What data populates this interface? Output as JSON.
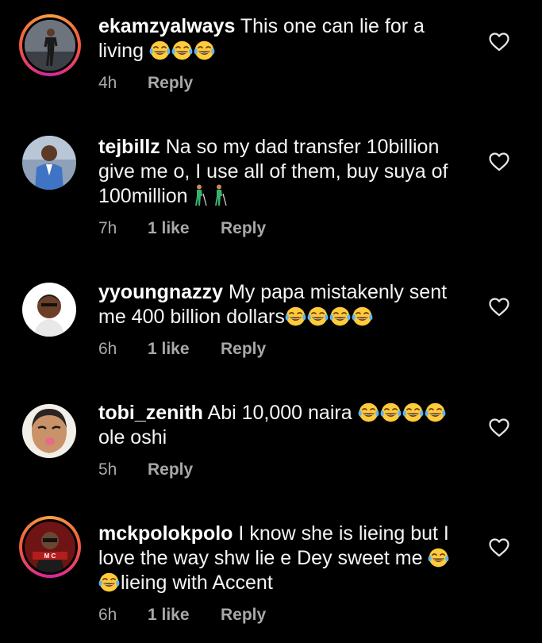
{
  "comments": [
    {
      "username": "ekamzyalways",
      "text_parts": [
        "This one can lie for a living "
      ],
      "emoji_after": 3,
      "time": "4h",
      "likes": "",
      "reply": "Reply",
      "has_story_ring": true
    },
    {
      "username": "tejbillz",
      "text_parts": [
        "Na so my dad transfer 10billion give me o, I use all of them, buy suya of 100million"
      ],
      "walk_emoji_after": 2,
      "time": "7h",
      "likes": "1 like",
      "reply": "Reply",
      "has_story_ring": false
    },
    {
      "username": "yyoungnazzy",
      "text_parts": [
        "My papa mistakenly sent me 400 billion dollars"
      ],
      "emoji_after": 4,
      "time": "6h",
      "likes": "1 like",
      "reply": "Reply",
      "has_story_ring": false
    },
    {
      "username": "tobi_zenith",
      "text_parts": [
        "Abi 10,000 naira ",
        "ole oshi"
      ],
      "emoji_middle": 4,
      "time": "5h",
      "likes": "",
      "reply": "Reply",
      "has_story_ring": false
    },
    {
      "username": "mckpolokpolo",
      "text_parts": [
        "I know she is lieing but I love the way shw lie e Dey sweet me ",
        "lieing with  Accent"
      ],
      "emoji_middle": 2,
      "time": "6h",
      "likes": "1 like",
      "reply": "Reply",
      "has_story_ring": true
    }
  ],
  "icons": {
    "like": "heart-outline-icon",
    "laugh_emoji": "face-with-tears-of-joy-emoji",
    "walk_emoji": "person-with-cane-emoji"
  },
  "colors": {
    "background": "#000000",
    "text": "#f5f5f5",
    "meta": "#a8a8a8",
    "story_ring_start": "#f9a03f",
    "story_ring_end": "#d6249f"
  }
}
